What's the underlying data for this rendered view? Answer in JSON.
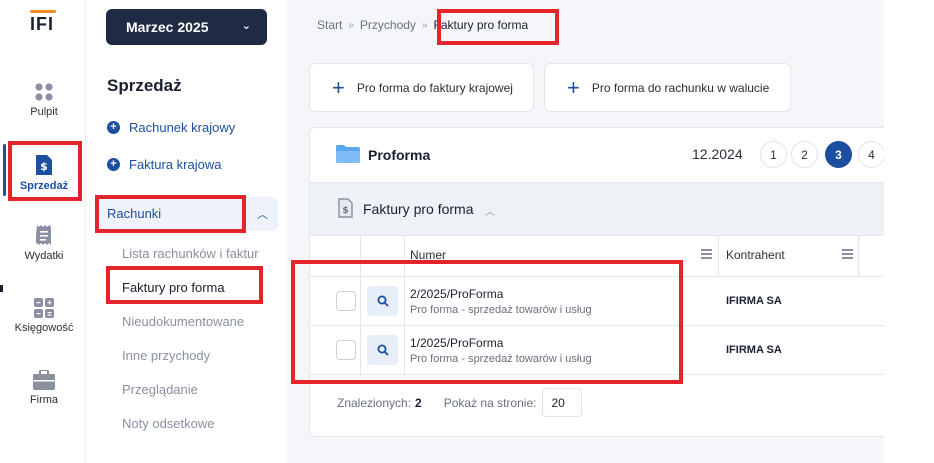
{
  "app": {
    "logo": "IFI",
    "logo_color": "#f08a24"
  },
  "rail": [
    {
      "label": "Pulpit",
      "icon": "grid-icon"
    },
    {
      "label": "Sprzedaż",
      "icon": "invoice-dollar-icon",
      "active": true
    },
    {
      "label": "Wydatki",
      "icon": "receipt-icon"
    },
    {
      "label": "Księgowość",
      "icon": "calculator-icon"
    },
    {
      "label": "Firma",
      "icon": "briefcase-icon"
    }
  ],
  "nav": {
    "month": "Marzec 2025",
    "section_title": "Sprzedaż",
    "quick_links": [
      "Rachunek krajowy",
      "Faktura krajowa"
    ],
    "group_label": "Rachunki",
    "sub_items": [
      "Lista rachunków i faktur",
      "Faktury pro forma",
      "Nieudokumentowane",
      "Inne przychody",
      "Przeglądanie",
      "Noty odsetkowe"
    ]
  },
  "breadcrumb": {
    "items": [
      "Start",
      "Przychody"
    ],
    "current": "Faktury pro forma",
    "separator": "»"
  },
  "actions": {
    "domestic": "Pro forma do faktury krajowej",
    "foreign": "Pro forma do rachunku w walucie"
  },
  "card": {
    "title": "Proforma",
    "period": "12.2024",
    "pages": [
      "1",
      "2",
      "3",
      "4"
    ],
    "active_page": "3",
    "subsection": "Faktury pro forma"
  },
  "table": {
    "columns": {
      "number": "Numer",
      "contractor": "Kontrahent"
    },
    "rows": [
      {
        "number": "2/2025/ProForma",
        "desc": "Pro forma - sprzedaż towarów i usług",
        "contractor": "IFIRMA SA"
      },
      {
        "number": "1/2025/ProForma",
        "desc": "Pro forma - sprzedaż towarów i usług",
        "contractor": "IFIRMA SA"
      }
    ]
  },
  "footer": {
    "found_label": "Znalezionych:",
    "found_count": "2",
    "per_page_label": "Pokaż na stronie:",
    "per_page_value": "20"
  },
  "colors": {
    "accent": "#1c4fa0",
    "highlight": "#e3242b",
    "month_button": "#1f2a44"
  }
}
